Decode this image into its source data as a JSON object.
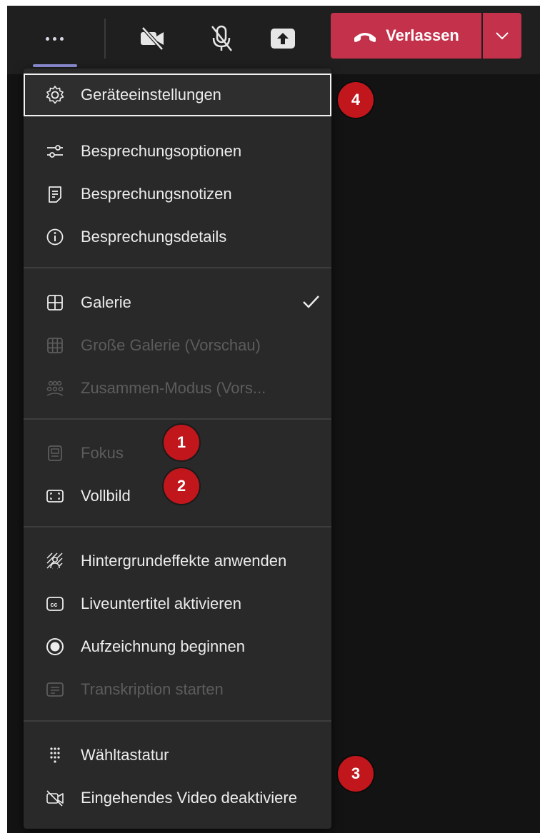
{
  "toolbar": {
    "leave_label": "Verlassen",
    "icons": [
      "more-options-icon",
      "camera-off-icon",
      "mic-off-icon",
      "share-screen-icon",
      "phone-hangup-icon",
      "chevron-down-icon"
    ]
  },
  "colors": {
    "leave_button": "#c4314b",
    "menu_background": "#292929",
    "active_underline": "#8f8fd9",
    "badge": "#c0161c"
  },
  "menu": {
    "section1": [
      {
        "label": "Geräteeinstellungen",
        "icon": "gear-icon",
        "focused": true
      },
      {
        "label": "Besprechungsoptionen",
        "icon": "sliders-icon"
      },
      {
        "label": "Besprechungsnotizen",
        "icon": "notes-icon"
      },
      {
        "label": "Besprechungsdetails",
        "icon": "info-icon"
      }
    ],
    "section2": [
      {
        "label": "Galerie",
        "icon": "grid-icon",
        "checked": true
      },
      {
        "label": "Große Galerie (Vorschau)",
        "icon": "large-grid-icon",
        "disabled": true
      },
      {
        "label": "Zusammen-Modus (Vors...",
        "icon": "together-mode-icon",
        "disabled": true
      }
    ],
    "section3": [
      {
        "label": "Fokus",
        "icon": "focus-icon",
        "disabled": true
      },
      {
        "label": "Vollbild",
        "icon": "fullscreen-icon"
      }
    ],
    "section4": [
      {
        "label": "Hintergrundeffekte anwenden",
        "icon": "background-effects-icon"
      },
      {
        "label": "Liveuntertitel aktivieren",
        "icon": "closed-captions-icon"
      },
      {
        "label": "Aufzeichnung beginnen",
        "icon": "record-icon"
      },
      {
        "label": "Transkription starten",
        "icon": "transcript-icon",
        "disabled": true
      }
    ],
    "section5": [
      {
        "label": "Wähltastatur",
        "icon": "dialpad-icon"
      },
      {
        "label": "Eingehendes Video deaktiviere",
        "icon": "video-off-icon"
      }
    ]
  },
  "badges": {
    "b1": "1",
    "b2": "2",
    "b3": "3",
    "b4": "4"
  }
}
